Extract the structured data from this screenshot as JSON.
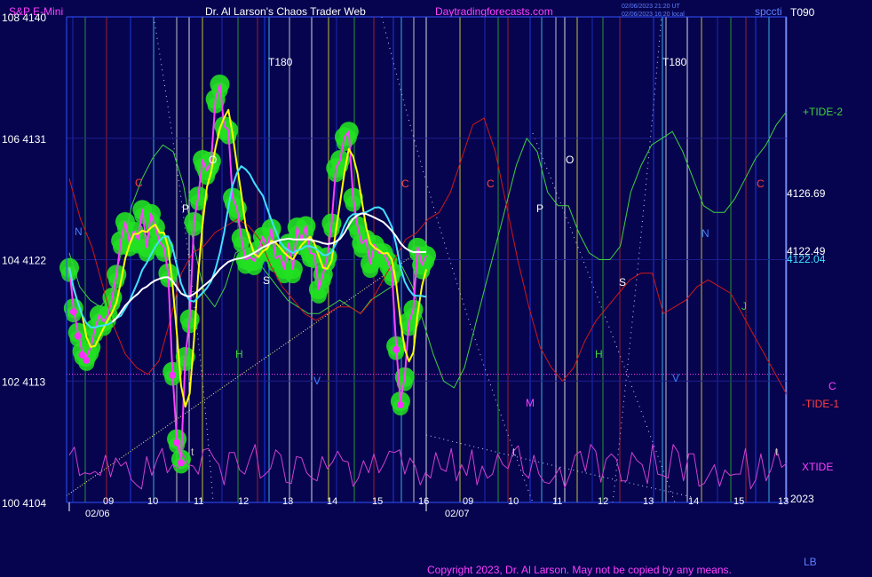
{
  "header": {
    "instrument": "S&P E-Mini",
    "title": "Dr. Al Larson's Chaos Trader Web",
    "site": "Daytradingforecasts.com",
    "stamp_line1": "02/06/2023 21:20 UT",
    "stamp_line2": "02/06/2023 16:20 local",
    "corner": "spccti"
  },
  "footer": {
    "copyright": "Copyright 2023, Dr. Al Larson. May not be copied by any means.",
    "corner": "LB",
    "year": "2023"
  },
  "colors": {
    "background": "#06044f",
    "price_bar": "#ff40ff",
    "ma_fast": "#ffff00",
    "ma_mid": "#40e0ff",
    "ma_slow": "#ffffff",
    "tide_plus": "#40d040",
    "tide_minus": "#d01818",
    "xtide": "#d040d0",
    "blob": "#22e022"
  },
  "chart_data": {
    "type": "line",
    "y_axis_left": {
      "labels": [
        "108 4140",
        "106 4131",
        "104 4122",
        "102 4113",
        "100 4104"
      ],
      "values": [
        4140,
        4131,
        4122,
        4113,
        4104
      ]
    },
    "ylim": [
      4104,
      4140
    ],
    "x_axis": {
      "hour_labels": [
        "09",
        "10",
        "11",
        "12",
        "13",
        "14",
        "15",
        "16",
        "09",
        "10",
        "11",
        "12",
        "13",
        "14",
        "15",
        "13"
      ],
      "date_labels": [
        "02/06",
        "02/07"
      ]
    },
    "right_labels": [
      {
        "text": "T090",
        "color": "#ffffff"
      },
      {
        "text": "+TIDE-2",
        "color": "#40d040"
      },
      {
        "text": "4126.69",
        "color": "#ffffff"
      },
      {
        "text": "4122.49",
        "color": "#ffffff"
      },
      {
        "text": "4122.04",
        "color": "#40e0ff"
      },
      {
        "text": "C",
        "color": "#ff40ff"
      },
      {
        "text": "-TIDE-1",
        "color": "#ff4040"
      },
      {
        "text": "XTIDE",
        "color": "#ff40ff"
      }
    ],
    "annotations": [
      {
        "text": "T180",
        "color": "#ffffff"
      },
      {
        "text": "T180",
        "color": "#ffffff"
      },
      {
        "text": "N",
        "color": "#4080ff"
      },
      {
        "text": "C",
        "color": "#ff4040"
      },
      {
        "text": "P",
        "color": "#ffffff"
      },
      {
        "text": "O",
        "color": "#ffffff"
      },
      {
        "text": "S",
        "color": "#ffffff"
      },
      {
        "text": "H",
        "color": "#40d040"
      },
      {
        "text": "V",
        "color": "#4080ff"
      },
      {
        "text": "C",
        "color": "#ff4040"
      },
      {
        "text": "C",
        "color": "#ff4040"
      },
      {
        "text": "P",
        "color": "#ffffff"
      },
      {
        "text": "O",
        "color": "#ffffff"
      },
      {
        "text": "M",
        "color": "#ff40ff"
      },
      {
        "text": "H",
        "color": "#40d040"
      },
      {
        "text": "S",
        "color": "#ffffff"
      },
      {
        "text": "N",
        "color": "#4080ff"
      },
      {
        "text": "V",
        "color": "#4080ff"
      },
      {
        "text": "C",
        "color": "#ff4040"
      },
      {
        "text": "J",
        "color": "#40d040"
      },
      {
        "text": "t",
        "color": "#c0c0c0"
      },
      {
        "text": "t",
        "color": "#c0c0c0"
      },
      {
        "text": "t",
        "color": "#c0c0c0"
      }
    ],
    "series": [
      {
        "key": "price",
        "color": "#ff40ff",
        "values": [
          4121.4,
          4118.4,
          4116.6,
          4115.2,
          4114.8,
          4115.5,
          4116.9,
          4117.9,
          4117.4,
          4117.9,
          4119.2,
          4120.9,
          4123.4,
          4124.8,
          4123.3,
          4124.1,
          4123.5,
          4125.7,
          4122.9,
          4125.4,
          4124.4,
          4123.3,
          4122.9,
          4121.0,
          4113.7,
          4108.7,
          4107.2,
          4114.8,
          4117.6,
          4124.8,
          4126.7,
          4129.4,
          4128.6,
          4129.3,
          4133.9,
          4135.0,
          4131.9,
          4131.6,
          4126.6,
          4125.8,
          4123.6,
          4122.0,
          4122.2,
          4121.9,
          4122.7,
          4123.7,
          4122.9,
          4124.3,
          4122.1,
          4122.3,
          4121.3,
          4123.2,
          4121.3,
          4124.4,
          4123.4,
          4124.5,
          4122.5,
          4122.4,
          4119.8,
          4120.9,
          4122.2,
          4124.7,
          4128.8,
          4129.4,
          4131.1,
          4131.5,
          4126.6,
          4124.5,
          4123.2,
          4123.5,
          4121.7,
          4123.1,
          4122.5,
          4122.5,
          4121.9,
          4121.1,
          4115.6,
          4111.5,
          4113.3,
          4117.4,
          4118.3,
          4122.9,
          4121.6,
          4122.3
        ]
      },
      {
        "key": "ma_fast",
        "color": "#ffff00"
      },
      {
        "key": "ma_mid",
        "color": "#40e0ff"
      },
      {
        "key": "ma_slow",
        "color": "#ffffff"
      },
      {
        "key": "tide_plus",
        "color": "#40d040",
        "values": [
          4122.5,
          4120.0,
          4119.0,
          4118.5,
          4119.5,
          4122.5,
          4126.0,
          4128.0,
          4129.5,
          4130.5,
          4130.0,
          4127.5,
          4123.0,
          4119.5,
          4118.5,
          4120.0,
          4122.5,
          4123.0,
          4122.0,
          4121.0,
          4120.0,
          4119.0,
          4118.5,
          4118.0,
          4118.0,
          4118.5,
          4119.0,
          4118.5,
          4118.0,
          4119.0,
          4119.5,
          4120.0,
          4121.5,
          4120.0,
          4117.5,
          4115.0,
          4113.0,
          4112.5,
          4114.0,
          4117.0,
          4120.0,
          4123.0,
          4126.0,
          4129.0,
          4131.0,
          4130.0,
          4127.0,
          4126.0,
          4126.0,
          4124.0,
          4122.5,
          4122.0,
          4122.0,
          4123.0,
          4127.0,
          4129.0,
          4130.5,
          4131.0,
          4131.5,
          4130.0,
          4128.0,
          4126.0,
          4125.5,
          4125.5,
          4126.5,
          4128.0,
          4129.5,
          4130.5,
          4132.0,
          4133.0
        ]
      },
      {
        "key": "tide_minus",
        "color": "#d01818",
        "values": [
          4128.0,
          4125.0,
          4123.0,
          4120.0,
          4117.0,
          4115.0,
          4114.0,
          4113.5,
          4114.5,
          4117.5,
          4121.0,
          4122.5,
          4123.0,
          4124.0,
          4124.5,
          4125.0,
          4124.5,
          4123.5,
          4121.5,
          4120.0,
          4119.0,
          4118.0,
          4117.5,
          4118.0,
          4118.5,
          4118.5,
          4118.0,
          4119.0,
          4120.5,
          4122.0,
          4123.5,
          4124.0,
          4125.0,
          4125.5,
          4127.0,
          4129.5,
          4132.0,
          4132.5,
          4130.0,
          4126.0,
          4122.0,
          4118.5,
          4115.5,
          4114.0,
          4113.0,
          4114.0,
          4116.0,
          4117.5,
          4118.5,
          4119.5,
          4120.5,
          4121.0,
          4121.0,
          4118.0,
          4118.5,
          4119.0,
          4120.0,
          4120.5,
          4120.0,
          4119.5,
          4118.0,
          4116.5,
          4115.0,
          4113.5,
          4112.0
        ]
      },
      {
        "key": "xtide",
        "color": "#d040d0",
        "values": [
          4107.5,
          4108.1,
          4106.0,
          4106.2,
          4106.1,
          4106.3,
          4106.0,
          4107.5,
          4105.9,
          4107.3,
          4106.7,
          4107.0,
          4105.7,
          4105.3,
          4105.0,
          4107.4,
          4106.0,
          4107.2,
          4108.0,
          4106.2,
          4106.8,
          4106.5,
          4107.6,
          4106.8,
          4106.7,
          4106.1,
          4107.9,
          4108.0,
          4107.3,
          4106.8,
          4105.3,
          4107.7,
          4107.7,
          4106.4,
          4106.1,
          4107.3,
          4108.3,
          4105.8,
          4106.1,
          4106.5,
          4107.9,
          4107.5,
          4105.5,
          4105.4,
          4107.4,
          4107.3,
          4106.2,
          4105.8,
          4105.6,
          4107.4,
          4106.5,
          4107.0,
          4107.8,
          4107.1,
          4107.0,
          4105.2,
          4105.8,
          4107.1,
          4106.2,
          4107.6,
          4106.2,
          4106.9,
          4107.8,
          4107.7,
          4107.9,
          4106.1,
          4107.3,
          4106.7,
          4105.3,
          4106.2,
          4105.8,
          4107.7,
          4106.5,
          4106.3,
          4108.0,
          4105.6,
          4106.8,
          4106.0,
          4107.9,
          4105.3,
          4106.7,
          4105.8,
          4106.1,
          4107.6,
          4106.8,
          4106.5,
          4107.8,
          4108.2,
          4106.2,
          4105.8,
          4107.5,
          4106.1,
          4105.5,
          4105.4,
          4105.9,
          4106.6,
          4105.1,
          4106.1,
          4107.5,
          4107.8,
          4106.3,
          4108.3,
          4107.8,
          4105.5,
          4107.2,
          4107.6,
          4107.2,
          4105.6,
          4105.6,
          4107.7,
          4107.1,
          4106.8,
          4105.4,
          4108.3,
          4106.1,
          4106.0,
          4105.8,
          4108.3,
          4107.7,
          4105.6,
          4107.6,
          4107.6,
          4105.2,
          4105.4,
          4106.1,
          4106.8,
          4105.2,
          4106.4,
          4106.0,
          4106.1,
          4106.1,
          4108.0,
          4105.0,
          4105.7,
          4107.6,
          4105.6,
          4106.5,
          4108.0,
          4106.6,
          4106.9
        ]
      }
    ],
    "reference_level": 4113.5,
    "trendline": {
      "from": 4104.5,
      "to": 4123.0
    }
  }
}
